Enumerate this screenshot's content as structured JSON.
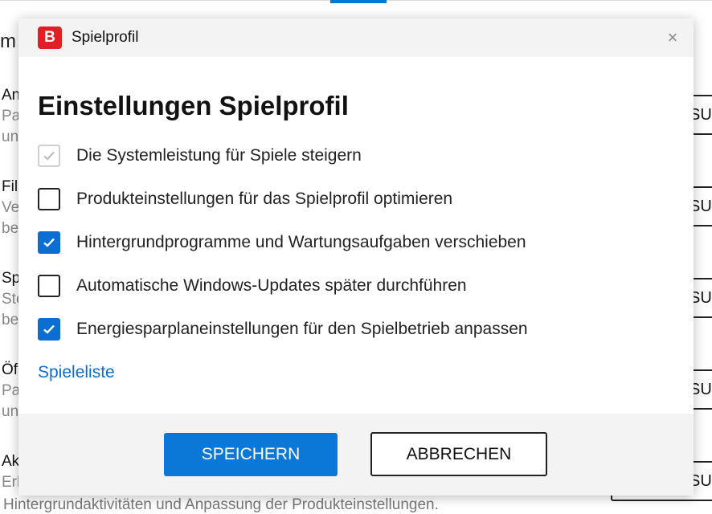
{
  "background": {
    "title_fragment": "m",
    "items": [
      {
        "title": "An",
        "desc1": "Pa",
        "desc2": "un"
      },
      {
        "title": "Fil",
        "desc1": "Ve",
        "desc2": "be"
      },
      {
        "title": "Sp",
        "desc1": "Ste",
        "desc2": "be"
      },
      {
        "title": "Öf",
        "desc1": "Pa",
        "desc2": "un"
      },
      {
        "title": "Ak",
        "desc1": "Erl",
        "desc2": ""
      }
    ],
    "button_fragment": "SUF",
    "footer_text": "Hintergrundaktivitäten und Anpassung der Produkteinstellungen."
  },
  "dialog": {
    "app_icon_letter": "B",
    "title": "Spielprofil",
    "close_glyph": "×",
    "heading": "Einstellungen Spielprofil",
    "options": [
      {
        "label": "Die Systemleistung für Spiele steigern",
        "checked": true,
        "disabled": true
      },
      {
        "label": "Produkteinstellungen für das Spielprofil optimieren",
        "checked": false,
        "disabled": false
      },
      {
        "label": "Hintergrundprogramme und Wartungsaufgaben verschieben",
        "checked": true,
        "disabled": false
      },
      {
        "label": "Automatische Windows-Updates später durchführen",
        "checked": false,
        "disabled": false
      },
      {
        "label": "Energiesparplaneinstellungen für den Spielbetrieb anpassen",
        "checked": true,
        "disabled": false
      }
    ],
    "link": "Spieleliste",
    "save_label": "SPEICHERN",
    "cancel_label": "ABBRECHEN"
  },
  "colors": {
    "accent": "#0b6ed0",
    "brand_red": "#e31f26"
  },
  "icons": {
    "app": "bitdefender-b-icon",
    "close": "close-icon",
    "check": "checkmark-icon"
  }
}
